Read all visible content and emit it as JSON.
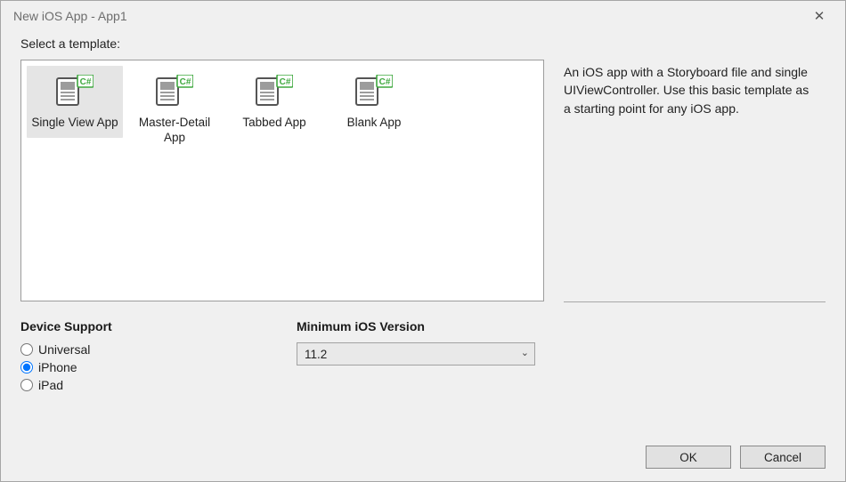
{
  "window": {
    "title": "New iOS App - App1",
    "close_glyph": "✕"
  },
  "prompt": "Select a template:",
  "templates": [
    {
      "name": "Single View App",
      "selected": true,
      "icon": "template-csharp-icon"
    },
    {
      "name": "Master-Detail App",
      "selected": false,
      "icon": "template-csharp-icon"
    },
    {
      "name": "Tabbed App",
      "selected": false,
      "icon": "template-csharp-icon"
    },
    {
      "name": "Blank App",
      "selected": false,
      "icon": "template-csharp-icon"
    }
  ],
  "description": "An iOS app with a Storyboard file and single UIViewController. Use this basic template as a starting point for any iOS app.",
  "device_support": {
    "title": "Device Support",
    "options": [
      "Universal",
      "iPhone",
      "iPad"
    ],
    "selected": "iPhone"
  },
  "min_ios": {
    "title": "Minimum iOS Version",
    "selected": "11.2"
  },
  "buttons": {
    "ok": "OK",
    "cancel": "Cancel"
  }
}
